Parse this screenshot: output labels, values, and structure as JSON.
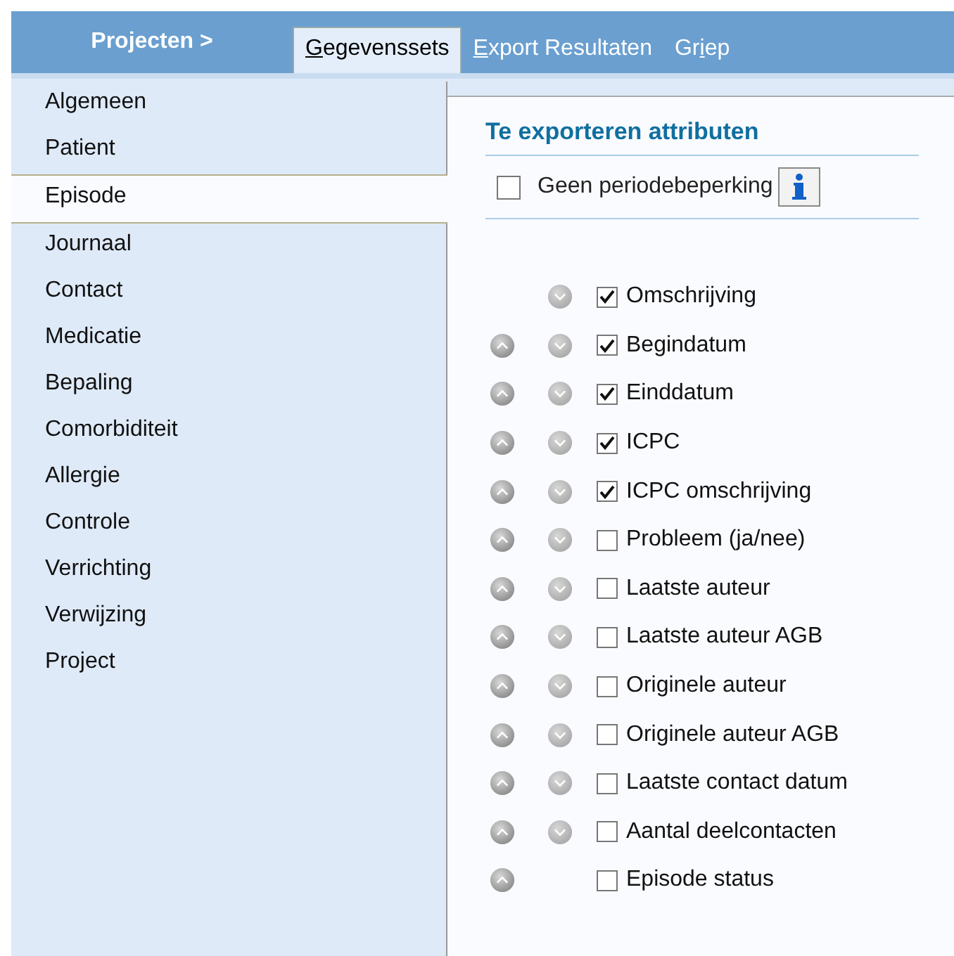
{
  "header": {
    "title": "Projecten >",
    "tabs": [
      {
        "key": "G",
        "after": "egevenssets",
        "selected": true
      },
      {
        "key": "E",
        "after": "xport Resultaten",
        "selected": false
      },
      {
        "before": "Gr",
        "key": "i",
        "after": "ep",
        "selected": false
      }
    ]
  },
  "sidebar": {
    "items": [
      {
        "label": "Algemeen",
        "selected": false
      },
      {
        "label": "Patient",
        "selected": false
      },
      {
        "label": "Episode",
        "selected": true
      },
      {
        "label": "Journaal",
        "selected": false
      },
      {
        "label": "Contact",
        "selected": false
      },
      {
        "label": "Medicatie",
        "selected": false
      },
      {
        "label": "Bepaling",
        "selected": false
      },
      {
        "label": "Comorbiditeit",
        "selected": false
      },
      {
        "label": "Allergie",
        "selected": false
      },
      {
        "label": "Controle",
        "selected": false
      },
      {
        "label": "Verrichting",
        "selected": false
      },
      {
        "label": "Verwijzing",
        "selected": false
      },
      {
        "label": "Project",
        "selected": false
      }
    ]
  },
  "panel": {
    "title": "Te exporteren attributen",
    "period_option": {
      "label": "Geen periodebeperking",
      "checked": false
    },
    "attributes": [
      {
        "label": "Omschrijving",
        "checked": true,
        "can_move_up": false,
        "can_move_down": true
      },
      {
        "label": "Begindatum",
        "checked": true,
        "can_move_up": true,
        "can_move_down": true
      },
      {
        "label": "Einddatum",
        "checked": true,
        "can_move_up": true,
        "can_move_down": true
      },
      {
        "label": "ICPC",
        "checked": true,
        "can_move_up": true,
        "can_move_down": true
      },
      {
        "label": "ICPC omschrijving",
        "checked": true,
        "can_move_up": true,
        "can_move_down": true
      },
      {
        "label": "Probleem (ja/nee)",
        "checked": false,
        "can_move_up": true,
        "can_move_down": true
      },
      {
        "label": "Laatste auteur",
        "checked": false,
        "can_move_up": true,
        "can_move_down": true
      },
      {
        "label": "Laatste auteur AGB",
        "checked": false,
        "can_move_up": true,
        "can_move_down": true
      },
      {
        "label": "Originele auteur",
        "checked": false,
        "can_move_up": true,
        "can_move_down": true
      },
      {
        "label": "Originele auteur AGB",
        "checked": false,
        "can_move_up": true,
        "can_move_down": true
      },
      {
        "label": "Laatste contact datum",
        "checked": false,
        "can_move_up": true,
        "can_move_down": true
      },
      {
        "label": "Aantal deelcontacten",
        "checked": false,
        "can_move_up": true,
        "can_move_down": true
      },
      {
        "label": "Episode status",
        "checked": false,
        "can_move_up": true,
        "can_move_down": false
      }
    ]
  }
}
